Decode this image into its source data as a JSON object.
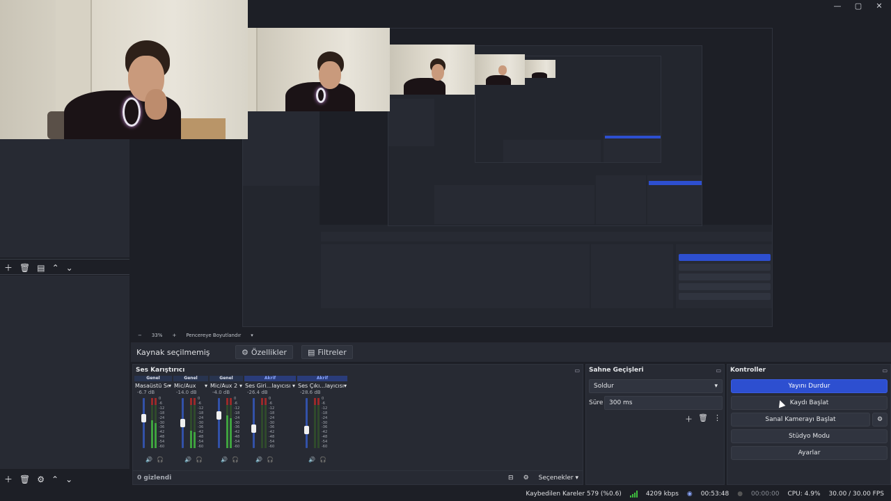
{
  "window": {
    "controls": {
      "minimize": "—",
      "maximize": "▢",
      "close": "✕"
    }
  },
  "preview": {
    "zoom": "33%",
    "zoom_minus": "−",
    "zoom_plus": "+",
    "resize_label": "Pencereye Boyutlandır"
  },
  "sources": {
    "no_source_label": "Kaynak seçilmemiş",
    "properties_label": "Özellikler",
    "filters_label": "Filtreler"
  },
  "mixer": {
    "title": "Ses Karıştırıcı",
    "hidden_label": "0 gizlendi",
    "options_label": "Seçenekler",
    "scale": [
      "0",
      "-6",
      "-12",
      "-18",
      "-24",
      "-30",
      "-36",
      "-42",
      "-48",
      "-54",
      "-60"
    ],
    "channels": [
      {
        "tag": "Genel",
        "tag_style": "genel",
        "name": "Masaüstü Ses",
        "db": "-6.7 dB",
        "level": 0.55,
        "fader": 0.62
      },
      {
        "tag": "Genel",
        "tag_style": "genel",
        "name": "Mic/Aux",
        "db": "-14.0 dB",
        "level": 0.35,
        "fader": 0.5
      },
      {
        "tag": "Genel",
        "tag_style": "genel",
        "name": "Mic/Aux 2",
        "db": "-4.0 dB",
        "level": 0.65,
        "fader": 0.68
      },
      {
        "tag": "Akrif",
        "tag_style": "akrif",
        "name": "Ses Giri...layıcısı",
        "db": "-26.4 dB",
        "level": 0.0,
        "fader": 0.36
      },
      {
        "tag": "Akrif",
        "tag_style": "akrif",
        "name": "Ses Çıkı...layıcısı",
        "db": "-28.6 dB",
        "level": 0.0,
        "fader": 0.34
      }
    ]
  },
  "transitions": {
    "title": "Sahne Geçişleri",
    "selected": "Soldur",
    "duration_label": "Süre",
    "duration_value": "300 ms"
  },
  "controls": {
    "title": "Kontroller",
    "stop_stream": "Yayını Durdur",
    "start_recording": "Kaydı Başlat",
    "start_virtual_cam": "Sanal Kamerayı Başlat",
    "studio_mode": "Stüdyo Modu",
    "settings": "Ayarlar"
  },
  "status": {
    "dropped_frames": "Kaybedilen Kareler 579 (%0.6)",
    "bitrate": "4209 kbps",
    "stream_time": "00:53:48",
    "rec_time": "00:00:00",
    "cpu": "CPU: 4.9%",
    "fps": "30.00 / 30.00 FPS"
  },
  "colors": {
    "accent": "#2d4fd0",
    "bg": "#1d1f26",
    "panel": "#272a33"
  }
}
